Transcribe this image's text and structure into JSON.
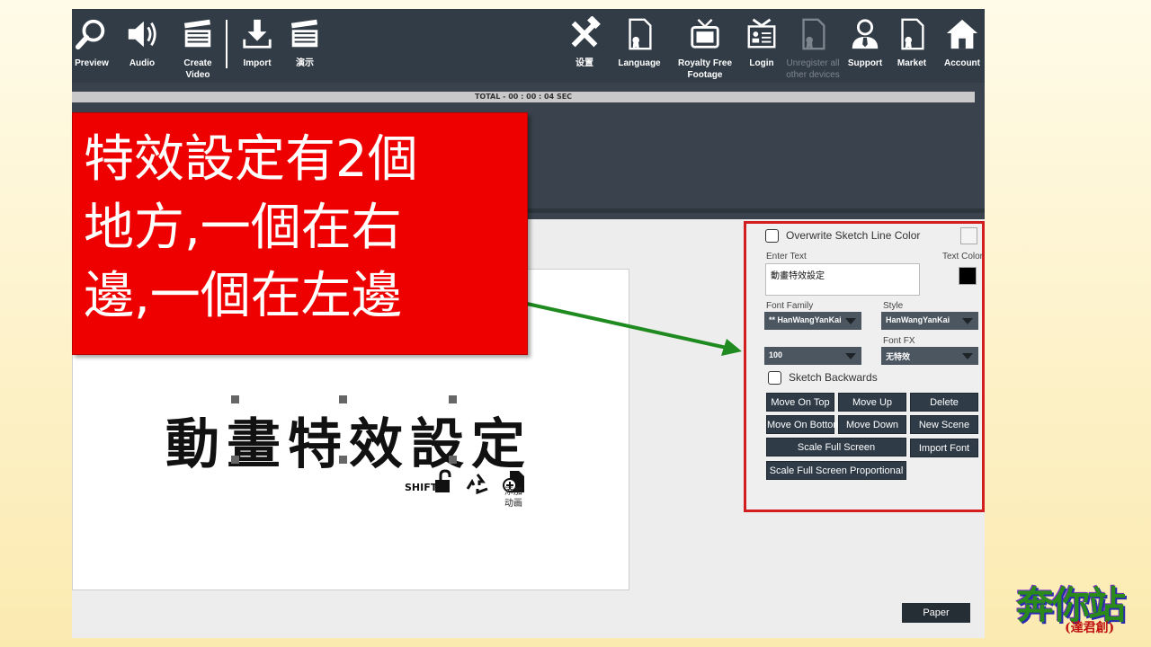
{
  "toolbar": {
    "items": [
      {
        "label": "Preview",
        "icon": "search-icon"
      },
      {
        "label": "Audio",
        "icon": "speaker-icon"
      },
      {
        "label": "Create Video",
        "icon": "clapperboard-icon"
      },
      {
        "label": "Import",
        "icon": "download-icon"
      },
      {
        "label": "演示",
        "icon": "clapperboard-icon"
      },
      {
        "label": "设置",
        "icon": "tools-icon"
      },
      {
        "label": "Language",
        "icon": "document-ribbon-icon"
      },
      {
        "label": "Royalty Free Footage",
        "icon": "tv-icon"
      },
      {
        "label": "Login",
        "icon": "id-card-icon"
      },
      {
        "label": "Unregister all other devices",
        "icon": "document-ribbon-icon",
        "disabled": true
      },
      {
        "label": "Support",
        "icon": "user-tie-icon"
      },
      {
        "label": "Market",
        "icon": "document-ribbon-icon"
      },
      {
        "label": "Account",
        "icon": "home-icon"
      }
    ]
  },
  "timeline": {
    "total_label": "TOTAL -  00 : 00 : 04 SEC"
  },
  "callout": {
    "text": "特效設定有2個\n地方,一個在右\n邊,一個在左邊"
  },
  "canvas": {
    "sample_text": "動畫特效設定",
    "shift_label": "SHIFT",
    "add_animation_label": "添加\n动画"
  },
  "panel": {
    "overwrite_label": "Overwrite Sketch Line Color",
    "enter_text_label": "Enter Text",
    "text_value": "動畫特效設定",
    "text_color_label": "Text Color",
    "text_color": "#000000",
    "font_family_label": "Font Family",
    "font_family_value": "** HanWangYanKai",
    "style_label": "Style",
    "style_value": "HanWangYanKai",
    "size_value": "100",
    "font_fx_label": "Font FX",
    "font_fx_value": "无特效",
    "sketch_backwards_label": "Sketch Backwards",
    "buttons": {
      "move_on_top": "Move On Top",
      "move_up": "Move Up",
      "delete": "Delete",
      "move_on_bottom": "Move On Bottom",
      "move_down": "Move Down",
      "new_scene": "New Scene",
      "scale_full_screen": "Scale Full Screen",
      "import_font": "Import Font",
      "scale_full_screen_proportional": "Scale Full Screen Proportional"
    }
  },
  "footer": {
    "paper_label": "Paper"
  },
  "logo": {
    "text": "奔你站",
    "subtext": "(達君創)"
  },
  "colors": {
    "toolbar_bg": "#323c46",
    "callout_bg": "#ee0000",
    "highlight": "#d21e1e",
    "arrow": "#1f8a1f"
  }
}
